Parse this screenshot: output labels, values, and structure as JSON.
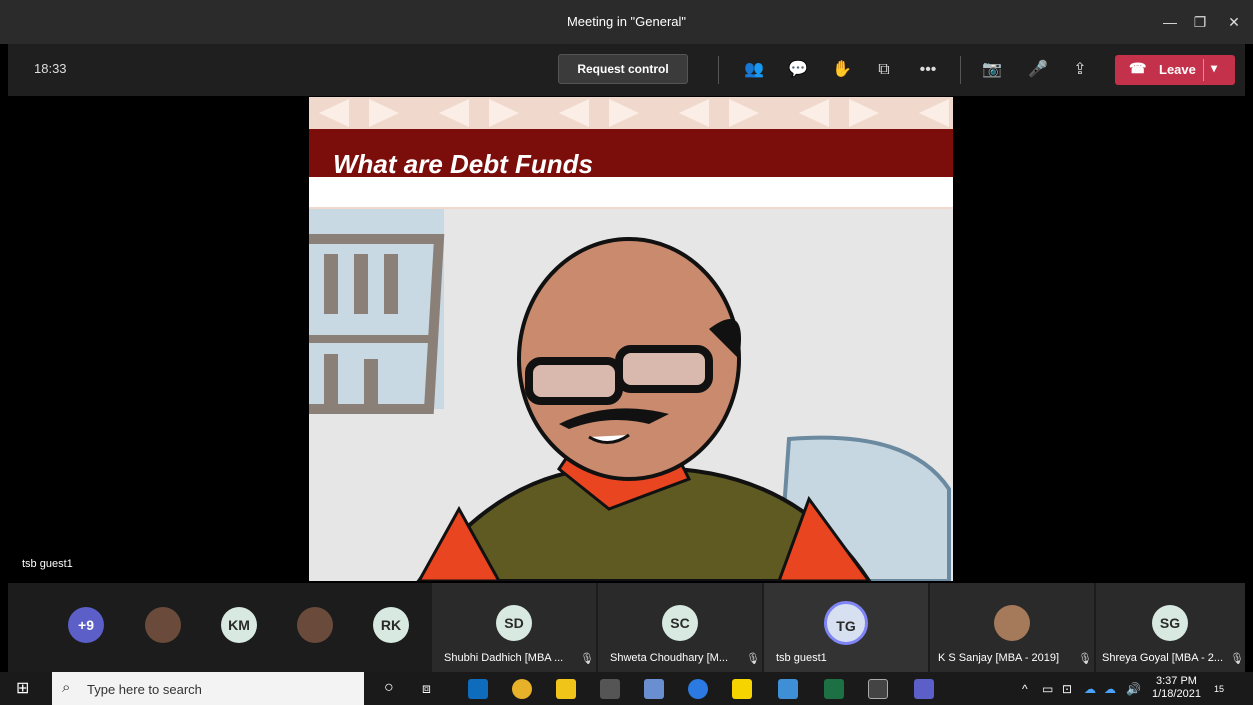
{
  "window": {
    "title": "Meeting in \"General\""
  },
  "toolbar": {
    "timer": "18:33",
    "request_control": "Request control",
    "leave_label": "Leave",
    "icons": [
      "people-icon",
      "chat-icon",
      "raise-hand-icon",
      "breakout-icon",
      "more-icon",
      "camera-off-icon",
      "mic-icon",
      "share-icon"
    ]
  },
  "slide": {
    "title": "What are Debt Funds"
  },
  "speaker_label": "tsb guest1",
  "participants": {
    "overflow": "+9",
    "small": [
      {
        "initials": "KM"
      },
      {
        "initials": "RK"
      }
    ],
    "tiles": [
      {
        "initials": "SD",
        "name": "Shubhi Dadhich [MBA ..."
      },
      {
        "initials": "SC",
        "name": "Shweta Choudhary [M..."
      },
      {
        "initials": "TG",
        "name": "tsb guest1"
      },
      {
        "initials": "",
        "name": "K S Sanjay [MBA - 2019]"
      },
      {
        "initials": "SG",
        "name": "Shreya Goyal [MBA - 2..."
      }
    ]
  },
  "taskbar": {
    "search_placeholder": "Type here to search",
    "time": "3:37 PM",
    "date": "1/18/2021",
    "notifications": "15"
  },
  "colors": {
    "leave": "#c4314b",
    "slide_red": "#7b0d0a",
    "teams_purple": "#5b5fc7"
  }
}
